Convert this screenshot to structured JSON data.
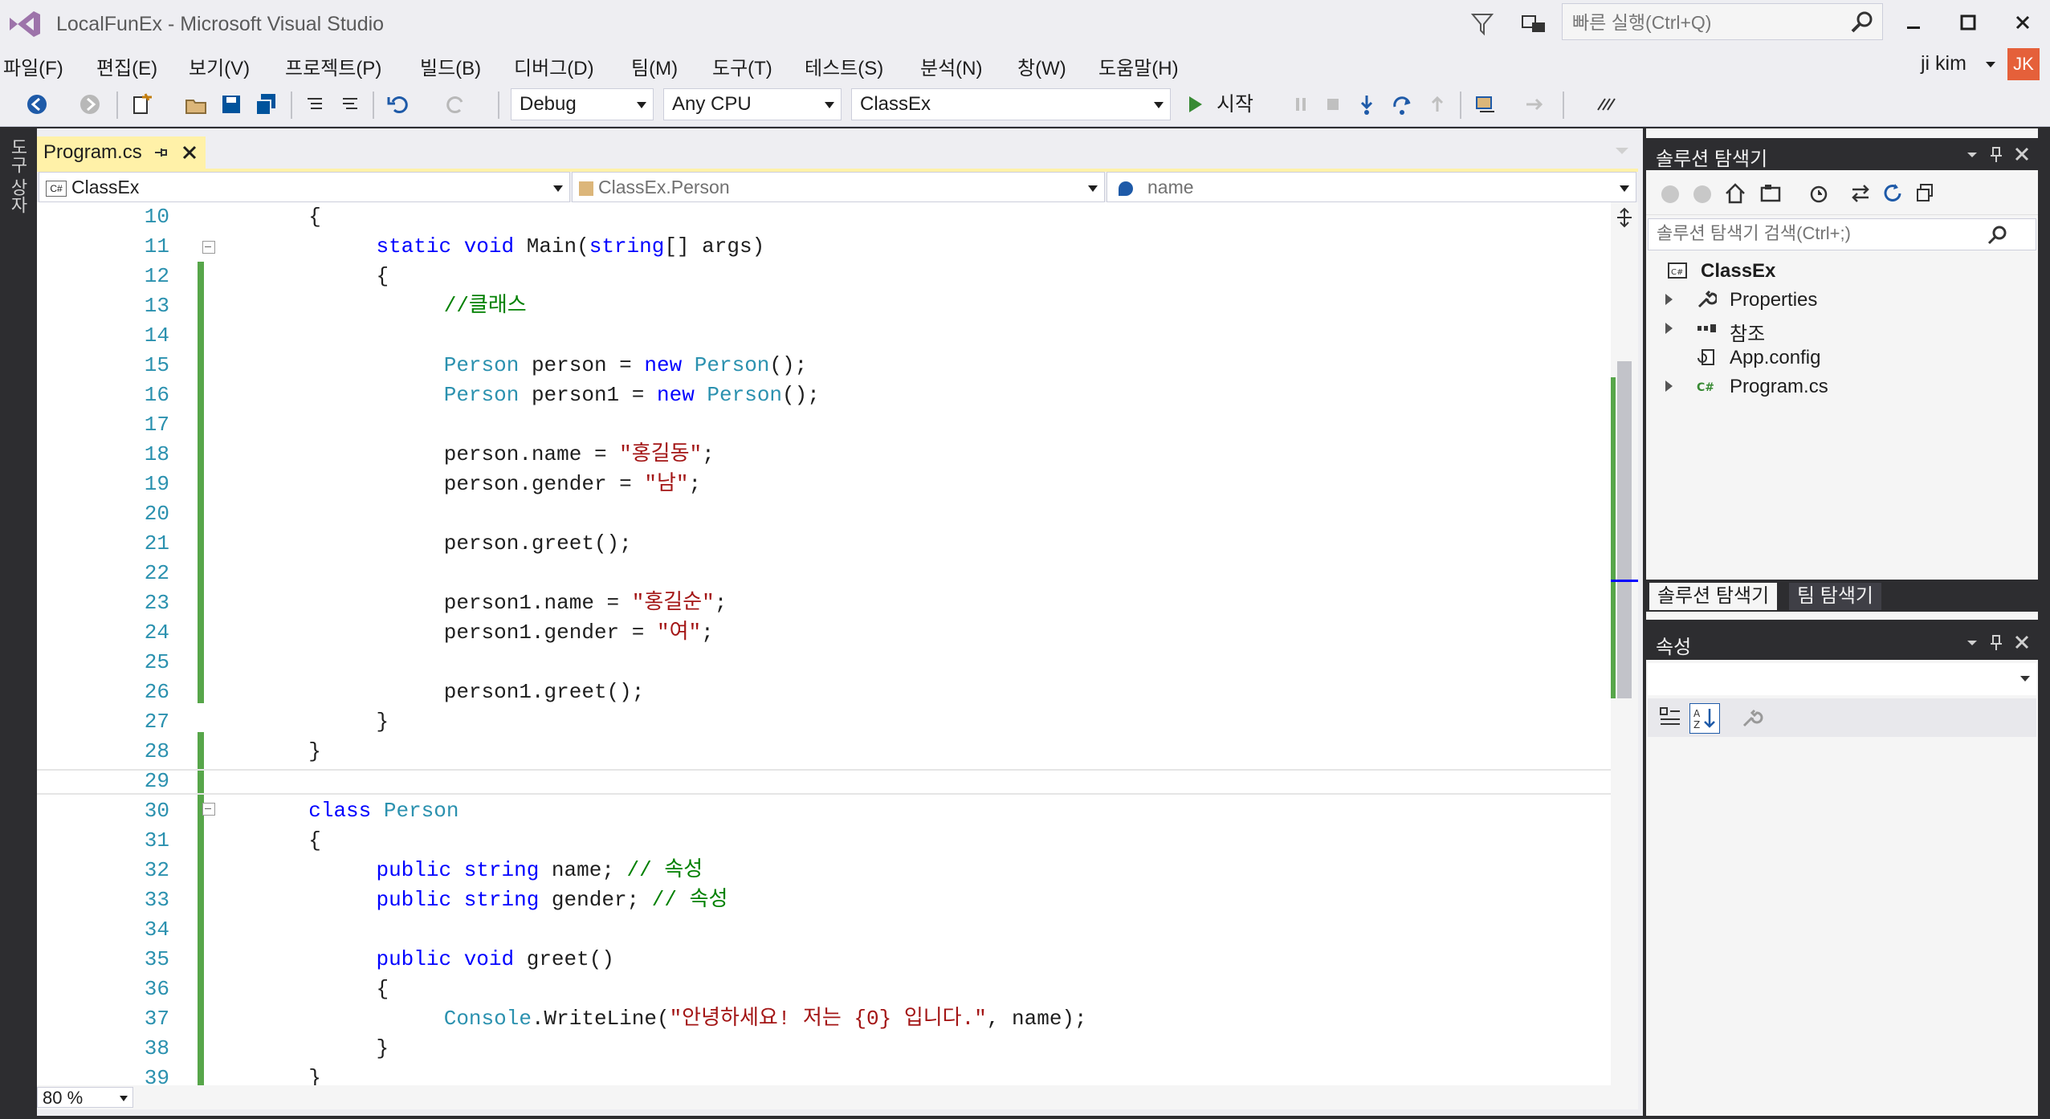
{
  "window": {
    "title": "LocalFunEx - Microsoft Visual Studio",
    "quick_launch_placeholder": "빠른 실행(Ctrl+Q)"
  },
  "menu": [
    {
      "label": "파일(F)"
    },
    {
      "label": "편집(E)"
    },
    {
      "label": "보기(V)"
    },
    {
      "label": "프로젝트(P)"
    },
    {
      "label": "빌드(B)"
    },
    {
      "label": "디버그(D)"
    },
    {
      "label": "팀(M)"
    },
    {
      "label": "도구(T)"
    },
    {
      "label": "테스트(S)"
    },
    {
      "label": "분석(N)"
    },
    {
      "label": "창(W)"
    },
    {
      "label": "도움말(H)"
    }
  ],
  "user": {
    "name": "ji kim",
    "initials": "JK",
    "avatar_color": "#e5603a"
  },
  "toolbar": {
    "config": "Debug",
    "platform": "Any CPU",
    "startup_project": "ClassEx",
    "start_label": "시작"
  },
  "toolbox_label": "도구 상자",
  "editor": {
    "tab_name": "Program.cs",
    "nav_project": "ClassEx",
    "nav_type": "ClassEx.Person",
    "nav_member": "name",
    "zoom": "80 %",
    "lines": [
      {
        "num": "10",
        "indent": 2,
        "tokens": [
          {
            "t": "{",
            "c": ""
          }
        ]
      },
      {
        "num": "11",
        "indent": 4,
        "tokens": [
          {
            "t": "static",
            "c": "kw"
          },
          {
            "t": " ",
            "c": ""
          },
          {
            "t": "void",
            "c": "kw"
          },
          {
            "t": " Main(",
            "c": ""
          },
          {
            "t": "string",
            "c": "kw"
          },
          {
            "t": "[] args)",
            "c": ""
          }
        ]
      },
      {
        "num": "12",
        "indent": 4,
        "tokens": [
          {
            "t": "{",
            "c": ""
          }
        ]
      },
      {
        "num": "13",
        "indent": 6,
        "tokens": [
          {
            "t": "//클래스",
            "c": "cm"
          }
        ]
      },
      {
        "num": "14",
        "indent": 0,
        "tokens": []
      },
      {
        "num": "15",
        "indent": 6,
        "tokens": [
          {
            "t": "Person",
            "c": "ty"
          },
          {
            "t": " person = ",
            "c": ""
          },
          {
            "t": "new",
            "c": "kw"
          },
          {
            "t": " ",
            "c": ""
          },
          {
            "t": "Person",
            "c": "ty"
          },
          {
            "t": "();",
            "c": ""
          }
        ]
      },
      {
        "num": "16",
        "indent": 6,
        "tokens": [
          {
            "t": "Person",
            "c": "ty"
          },
          {
            "t": " person1 = ",
            "c": ""
          },
          {
            "t": "new",
            "c": "kw"
          },
          {
            "t": " ",
            "c": ""
          },
          {
            "t": "Person",
            "c": "ty"
          },
          {
            "t": "();",
            "c": ""
          }
        ]
      },
      {
        "num": "17",
        "indent": 0,
        "tokens": []
      },
      {
        "num": "18",
        "indent": 6,
        "tokens": [
          {
            "t": "person.name = ",
            "c": ""
          },
          {
            "t": "\"홍길동\"",
            "c": "str"
          },
          {
            "t": ";",
            "c": ""
          }
        ]
      },
      {
        "num": "19",
        "indent": 6,
        "tokens": [
          {
            "t": "person.gender = ",
            "c": ""
          },
          {
            "t": "\"남\"",
            "c": "str"
          },
          {
            "t": ";",
            "c": ""
          }
        ]
      },
      {
        "num": "20",
        "indent": 0,
        "tokens": []
      },
      {
        "num": "21",
        "indent": 6,
        "tokens": [
          {
            "t": "person.greet();",
            "c": ""
          }
        ]
      },
      {
        "num": "22",
        "indent": 0,
        "tokens": []
      },
      {
        "num": "23",
        "indent": 6,
        "tokens": [
          {
            "t": "person1.name = ",
            "c": ""
          },
          {
            "t": "\"홍길순\"",
            "c": "str"
          },
          {
            "t": ";",
            "c": ""
          }
        ]
      },
      {
        "num": "24",
        "indent": 6,
        "tokens": [
          {
            "t": "person1.gender = ",
            "c": ""
          },
          {
            "t": "\"여\"",
            "c": "str"
          },
          {
            "t": ";",
            "c": ""
          }
        ]
      },
      {
        "num": "25",
        "indent": 0,
        "tokens": []
      },
      {
        "num": "26",
        "indent": 6,
        "tokens": [
          {
            "t": "person1.greet();",
            "c": ""
          }
        ]
      },
      {
        "num": "27",
        "indent": 4,
        "tokens": [
          {
            "t": "}",
            "c": ""
          }
        ]
      },
      {
        "num": "28",
        "indent": 2,
        "tokens": [
          {
            "t": "}",
            "c": ""
          }
        ]
      },
      {
        "num": "29",
        "indent": 0,
        "tokens": []
      },
      {
        "num": "30",
        "indent": 2,
        "tokens": [
          {
            "t": "class",
            "c": "kw"
          },
          {
            "t": " ",
            "c": ""
          },
          {
            "t": "Person",
            "c": "ty"
          }
        ]
      },
      {
        "num": "31",
        "indent": 2,
        "tokens": [
          {
            "t": "{",
            "c": ""
          }
        ]
      },
      {
        "num": "32",
        "indent": 4,
        "tokens": [
          {
            "t": "public",
            "c": "kw"
          },
          {
            "t": " ",
            "c": ""
          },
          {
            "t": "string",
            "c": "kw"
          },
          {
            "t": " name; ",
            "c": ""
          },
          {
            "t": "// 속성",
            "c": "cm"
          }
        ]
      },
      {
        "num": "33",
        "indent": 4,
        "tokens": [
          {
            "t": "public",
            "c": "kw"
          },
          {
            "t": " ",
            "c": ""
          },
          {
            "t": "string",
            "c": "kw"
          },
          {
            "t": " gender; ",
            "c": ""
          },
          {
            "t": "// 속성",
            "c": "cm"
          }
        ]
      },
      {
        "num": "34",
        "indent": 0,
        "tokens": []
      },
      {
        "num": "35",
        "indent": 4,
        "tokens": [
          {
            "t": "public",
            "c": "kw"
          },
          {
            "t": " ",
            "c": ""
          },
          {
            "t": "void",
            "c": "kw"
          },
          {
            "t": " greet()",
            "c": ""
          }
        ]
      },
      {
        "num": "36",
        "indent": 4,
        "tokens": [
          {
            "t": "{",
            "c": ""
          }
        ]
      },
      {
        "num": "37",
        "indent": 6,
        "tokens": [
          {
            "t": "Console",
            "c": "ty"
          },
          {
            "t": ".WriteLine(",
            "c": ""
          },
          {
            "t": "\"안녕하세요! 저는 {0} 입니다.\"",
            "c": "str"
          },
          {
            "t": ", name);",
            "c": ""
          }
        ]
      },
      {
        "num": "38",
        "indent": 4,
        "tokens": [
          {
            "t": "}",
            "c": ""
          }
        ]
      },
      {
        "num": "39",
        "indent": 2,
        "tokens": [
          {
            "t": "}",
            "c": ""
          }
        ]
      }
    ]
  },
  "solution_explorer": {
    "title": "솔루션 탐색기",
    "search_placeholder": "솔루션 탐색기 검색(Ctrl+;)",
    "project": "ClassEx",
    "items": [
      {
        "label": "Properties",
        "icon": "wrench-icon",
        "expandable": true
      },
      {
        "label": "참조",
        "icon": "references-icon",
        "expandable": true
      },
      {
        "label": "App.config",
        "icon": "config-icon",
        "expandable": false
      },
      {
        "label": "Program.cs",
        "icon": "csharp-file-icon",
        "expandable": true
      }
    ],
    "bottom_tabs": [
      "솔루션 탐색기",
      "팀 탐색기"
    ]
  },
  "properties": {
    "title": "속성"
  }
}
